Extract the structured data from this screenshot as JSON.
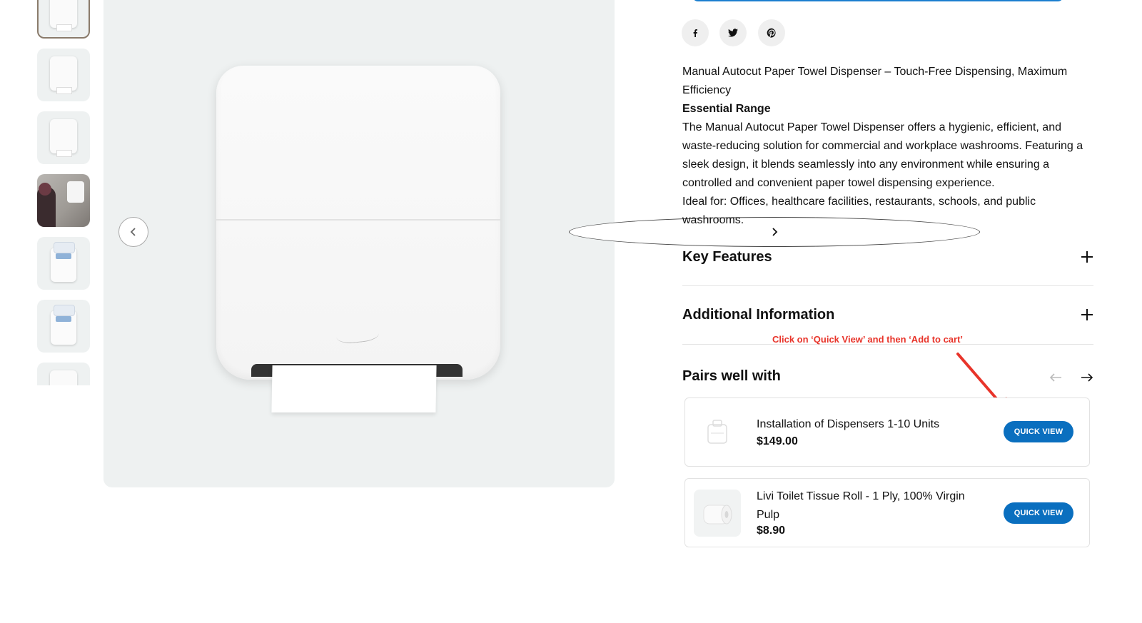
{
  "gallery": {
    "thumbnails": [
      "thumb-1",
      "thumb-2",
      "thumb-3",
      "thumb-4",
      "thumb-5",
      "thumb-6",
      "thumb-7"
    ],
    "active_index": 0
  },
  "share": {
    "icons": [
      "facebook-icon",
      "twitter-icon",
      "pinterest-icon"
    ]
  },
  "product": {
    "headline": "Manual Autocut Paper Towel Dispenser – Touch-Free Dispensing, Maximum Efficiency",
    "range": "Essential Range",
    "description": "The Manual Autocut Paper Towel Dispenser offers a hygienic, efficient, and waste-reducing solution for commercial and workplace washrooms. Featuring a sleek design, it blends seamlessly into any environment while ensuring a controlled and convenient paper towel dispensing experience.",
    "ideal_for": "Ideal for: Offices, healthcare facilities, restaurants, schools, and public washrooms."
  },
  "accordions": {
    "key_features": "Key Features",
    "additional_info": "Additional Information"
  },
  "annotation": {
    "text": "Click on ‘Quick View’ and then ‘Add to cart’",
    "color": "#e8342a"
  },
  "pairs": {
    "title": "Pairs well with",
    "items": [
      {
        "name": "Installation of Dispensers 1-10 Units",
        "price": "$149.00",
        "button": "QUICK VIEW"
      },
      {
        "name": "Livi Toilet Tissue Roll - 1 Ply, 100% Virgin Pulp",
        "price": "$8.90",
        "button": "QUICK VIEW"
      }
    ]
  },
  "colors": {
    "accent": "#0a6fbf",
    "gallery_bg": "#eef1f1"
  }
}
